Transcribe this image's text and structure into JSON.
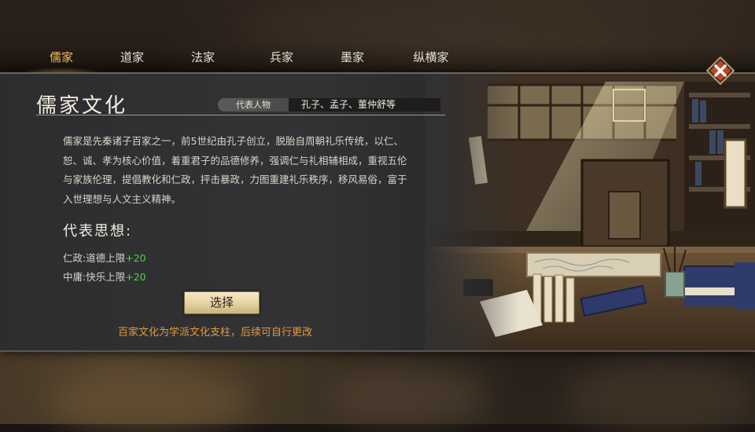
{
  "tabs": [
    {
      "label": "儒家",
      "active": true
    },
    {
      "label": "道家",
      "active": false
    },
    {
      "label": "法家",
      "active": false
    },
    {
      "label": "兵家",
      "active": false
    },
    {
      "label": "墨家",
      "active": false
    },
    {
      "label": "纵横家",
      "active": false
    }
  ],
  "panel": {
    "title": "儒家文化",
    "rep_label": "代表人物",
    "rep_value": "孔子、孟子、董仲舒等",
    "description": "儒家是先秦诸子百家之一，前5世纪由孔子创立，脱胎自周朝礼乐传统，以仁、恕、诚、孝为核心价值，着重君子的品德修养，强调仁与礼相辅相成，重视五伦与家族伦理，提倡教化和仁政，抨击暴政，力图重建礼乐秩序，移风易俗，富于入世理想与人文主义精神。",
    "ideas_title": "代表思想:",
    "ideas": [
      {
        "name": "仁政",
        "sep": ":",
        "effect": "道德上限",
        "bonus": "+20"
      },
      {
        "name": "中庸",
        "sep": ":",
        "effect": "快乐上限",
        "bonus": "+20"
      }
    ],
    "select_label": "选择",
    "note": "百家文化为学派文化支柱，后续可自行更改"
  },
  "colors": {
    "accent_gold": "#f6c25a",
    "bonus_green": "#47d64a",
    "note_orange": "#e39a3e",
    "close_red": "#c0432a"
  },
  "icons": {
    "close": "close-x-icon"
  }
}
